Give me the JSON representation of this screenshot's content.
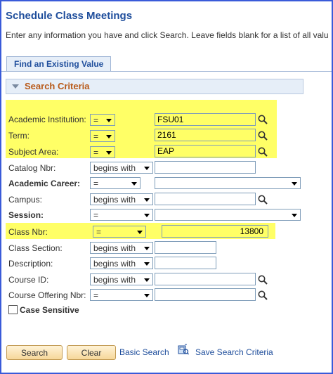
{
  "page": {
    "title": "Schedule Class Meetings",
    "instructions": "Enter any information you have and click Search. Leave fields blank for a list of all valu"
  },
  "tabs": [
    {
      "label": "Find an Existing Value"
    }
  ],
  "search_criteria": {
    "header": "Search Criteria",
    "fields": [
      {
        "label": "Academic Institution:",
        "operator": "=",
        "value": "FSU01"
      },
      {
        "label": "Term:",
        "operator": "=",
        "value": "2161"
      },
      {
        "label": "Subject Area:",
        "operator": "=",
        "value": "EAP"
      },
      {
        "label": "Catalog Nbr:",
        "operator": "begins with",
        "value": ""
      },
      {
        "label": "Academic Career:",
        "operator": "=",
        "value": ""
      },
      {
        "label": "Campus:",
        "operator": "begins with",
        "value": ""
      },
      {
        "label": "Session:",
        "operator": "=",
        "value": ""
      },
      {
        "label": "Class Nbr:",
        "operator": "=",
        "value": "13800"
      },
      {
        "label": "Class Section:",
        "operator": "begins with",
        "value": ""
      },
      {
        "label": "Description:",
        "operator": "begins with",
        "value": ""
      },
      {
        "label": "Course ID:",
        "operator": "begins with",
        "value": ""
      },
      {
        "label": "Course Offering Nbr:",
        "operator": "=",
        "value": ""
      }
    ],
    "case_sensitive_label": "Case Sensitive",
    "case_sensitive_checked": false
  },
  "actions": {
    "search_label": "Search",
    "clear_label": "Clear",
    "basic_search_label": "Basic Search",
    "save_search_label": "Save Search Criteria"
  },
  "colors": {
    "highlight": "#ffff66",
    "title_blue": "#1f4e9c",
    "header_orange": "#b85a1a",
    "frame_border": "#3a5bd9"
  }
}
